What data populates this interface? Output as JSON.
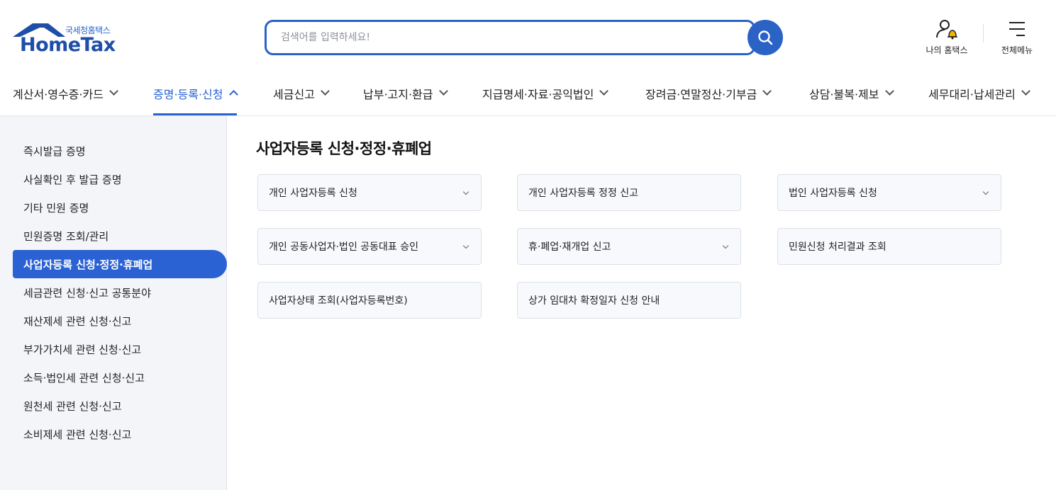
{
  "brand": {
    "sub": "국세청홈택스",
    "name": "HomeTax",
    "color": "#1e4ea8"
  },
  "search": {
    "placeholder": "검색어를 입력하세요!",
    "value": ""
  },
  "utility": {
    "my_hometax": "나의 홈택스",
    "all_menu": "전체메뉴"
  },
  "gnb": {
    "items": [
      {
        "label": "계산서·영수증·카드"
      },
      {
        "label": "증명·등록·신청"
      },
      {
        "label": "세금신고"
      },
      {
        "label": "납부·고지·환급"
      },
      {
        "label": "지급명세·자료·공익법인"
      },
      {
        "label": "장려금·연말정산·기부금"
      },
      {
        "label": "상담·불복·제보"
      },
      {
        "label": "세무대리·납세관리"
      }
    ],
    "active_index": 1
  },
  "sidebar": {
    "items": [
      {
        "label": "즉시발급 증명"
      },
      {
        "label": "사실확인 후 발급 증명"
      },
      {
        "label": "기타 민원 증명"
      },
      {
        "label": "민원증명 조회/관리"
      },
      {
        "label": "사업자등록 신청·정정·휴폐업"
      },
      {
        "label": "세금관련 신청·신고 공통분야"
      },
      {
        "label": "재산제세 관련 신청·신고"
      },
      {
        "label": "부가가치세 관련 신청·신고"
      },
      {
        "label": "소득·법인세 관련 신청·신고"
      },
      {
        "label": "원천세 관련 신청·신고"
      },
      {
        "label": "소비제세 관련 신청·신고"
      }
    ],
    "active_index": 4
  },
  "main": {
    "title": "사업자등록 신청·정정·휴폐업",
    "cards": [
      {
        "label": "개인 사업자등록 신청",
        "expandable": true
      },
      {
        "label": "개인 사업자등록 정정 신고",
        "expandable": false
      },
      {
        "label": "법인 사업자등록 신청",
        "expandable": true
      },
      {
        "label": "개인 공동사업자·법인 공동대표 승인",
        "expandable": true
      },
      {
        "label": "휴·폐업·재개업 신고",
        "expandable": true
      },
      {
        "label": "민원신청 처리결과 조회",
        "expandable": false
      },
      {
        "label": "사업자상태 조회(사업자등록번호)",
        "expandable": false
      },
      {
        "label": "상가 임대차 확정일자 신청 안내",
        "expandable": false
      }
    ]
  },
  "colors": {
    "accent": "#2a62d4",
    "search_border": "#2b62c6",
    "sidebar_bg": "#f3f5f9",
    "card_bg": "#f7f9fc",
    "bell": "#f4b400"
  }
}
